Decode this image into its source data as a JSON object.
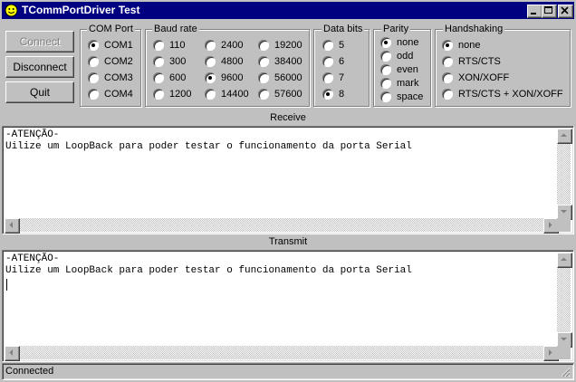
{
  "window": {
    "title": "TCommPortDriver Test"
  },
  "buttons": {
    "connect": "Connect",
    "disconnect": "Disconnect",
    "quit": "Quit"
  },
  "com_port": {
    "title": "COM Port",
    "options": [
      "COM1",
      "COM2",
      "COM3",
      "COM4"
    ],
    "selected": "COM1"
  },
  "baud_rate": {
    "title": "Baud rate",
    "options": [
      "110",
      "300",
      "600",
      "1200",
      "2400",
      "4800",
      "9600",
      "14400",
      "19200",
      "38400",
      "56000",
      "57600"
    ],
    "selected": "9600"
  },
  "data_bits": {
    "title": "Data bits",
    "options": [
      "5",
      "6",
      "7",
      "8"
    ],
    "selected": "8"
  },
  "parity": {
    "title": "Parity",
    "options": [
      "none",
      "odd",
      "even",
      "mark",
      "space"
    ],
    "selected": "none"
  },
  "handshaking": {
    "title": "Handshaking",
    "options": [
      "none",
      "RTS/CTS",
      "XON/XOFF",
      "RTS/CTS + XON/XOFF"
    ],
    "selected": "none"
  },
  "receive": {
    "label": "Receive",
    "lines": [
      "-ATENÇÃO-",
      "Uilize um LoopBack para poder testar o funcionamento da porta Serial"
    ]
  },
  "transmit": {
    "label": "Transmit",
    "lines": [
      "-ATENÇÃO-",
      "Uilize um LoopBack para poder testar o funcionamento da porta Serial"
    ]
  },
  "status": {
    "text": "Connected"
  },
  "icons": {
    "app": "smiley-icon",
    "minimize": "minimize-icon",
    "maximize": "maximize-icon",
    "close": "close-icon"
  }
}
